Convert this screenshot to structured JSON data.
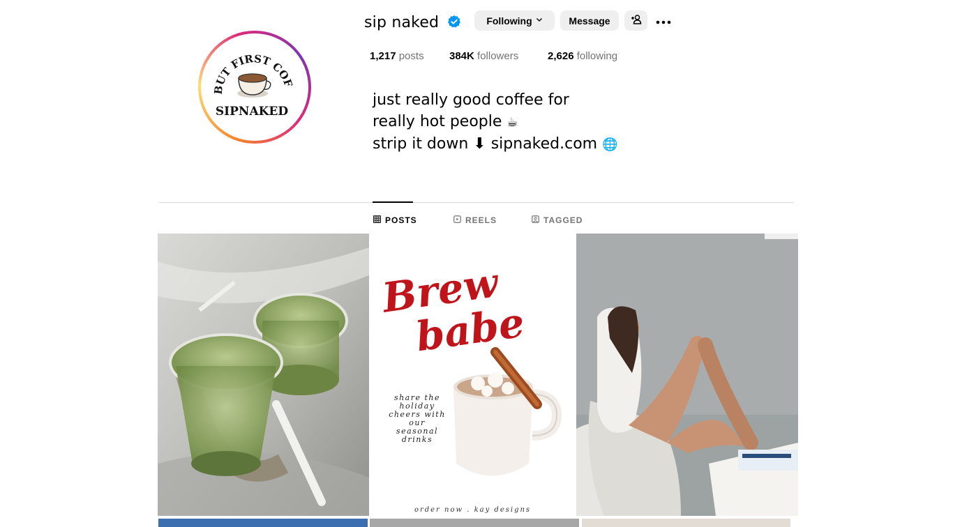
{
  "profile": {
    "username": "sip naked",
    "avatar_text_top": "BUT FIRST COFFEE",
    "avatar_text_bottom": "SIPNAKED",
    "buttons": {
      "following": "Following",
      "message": "Message",
      "add_user_icon": "person-plus-icon",
      "more_icon": "more-horizontal-icon"
    },
    "stats": {
      "posts_count": "1,217",
      "posts_label": "posts",
      "followers_count": "384K",
      "followers_label": "followers",
      "following_count": "2,626",
      "following_label": "following"
    },
    "bio": {
      "line1": "just really good coffee for",
      "line2": "really hot people",
      "line2_emoji": "☕",
      "line3": "strip it down ⬇ sipnaked.com",
      "line3_emoji": "🌐"
    }
  },
  "tabs": [
    {
      "label": "POSTS",
      "icon": "grid-icon",
      "active": true
    },
    {
      "label": "REELS",
      "icon": "reels-icon",
      "active": false
    },
    {
      "label": "TAGGED",
      "icon": "tagged-icon",
      "active": false
    }
  ],
  "posts": [
    {
      "kind": "photo",
      "subject": "two iced matcha lattes"
    },
    {
      "kind": "graphic",
      "title_line1": "Brew",
      "title_line2": "babe",
      "caption": "share the holiday cheers with our seasonal drinks",
      "footer": "order now . kay designs"
    },
    {
      "kind": "photo",
      "subject": "woman drinking coffee on chair"
    }
  ],
  "colors": {
    "accent_blue": "#0095f6",
    "button_bg": "#efefef",
    "brew_red": "#c0141b"
  }
}
